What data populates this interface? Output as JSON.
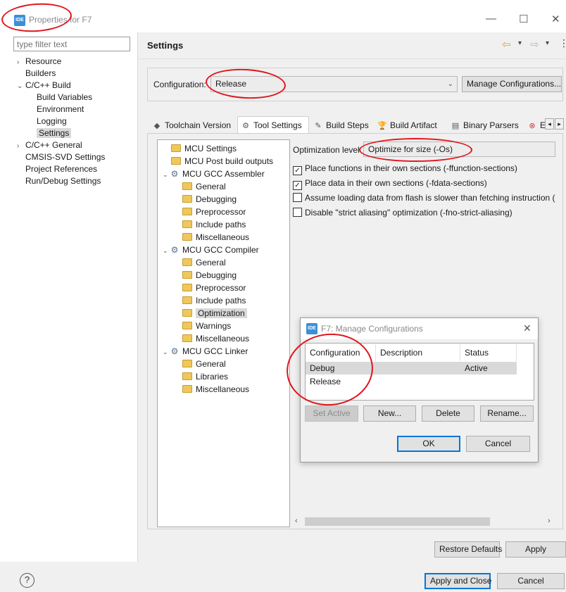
{
  "window": {
    "logo_text": "IDE",
    "title": "Properties for F7",
    "minimize": "—",
    "maximize": "☐",
    "close": "✕"
  },
  "left_tree": {
    "filter_placeholder": "type filter text",
    "items": [
      {
        "label": "Resource",
        "arrow": "›"
      },
      {
        "label": "Builders",
        "arrow": ""
      },
      {
        "label": "C/C++ Build",
        "arrow": "⌄"
      },
      {
        "label": "Build Variables",
        "arrow": ""
      },
      {
        "label": "Environment",
        "arrow": ""
      },
      {
        "label": "Logging",
        "arrow": ""
      },
      {
        "label": "Settings",
        "arrow": "",
        "selected": true
      },
      {
        "label": "C/C++ General",
        "arrow": "›"
      },
      {
        "label": "CMSIS-SVD Settings",
        "arrow": ""
      },
      {
        "label": "Project References",
        "arrow": ""
      },
      {
        "label": "Run/Debug Settings",
        "arrow": ""
      }
    ]
  },
  "settings": {
    "title": "Settings",
    "configuration_label": "Configuration:",
    "configuration_value": "Release",
    "manage_button": "Manage Configurations...",
    "tabs": [
      {
        "label": "Toolchain Version",
        "icon": "◆"
      },
      {
        "label": "Tool Settings",
        "icon": "⚙"
      },
      {
        "label": "Build Steps",
        "icon": "✎"
      },
      {
        "label": "Build Artifact",
        "icon": "🏆"
      },
      {
        "label": "Binary Parsers",
        "icon": "▤"
      },
      {
        "label": "E",
        "icon": "⊗"
      }
    ],
    "tool_tree": [
      {
        "label": "MCU Settings",
        "kind": "folder",
        "indent": 0
      },
      {
        "label": "MCU Post build outputs",
        "kind": "folder",
        "indent": 0
      },
      {
        "label": "MCU GCC Assembler",
        "kind": "gear",
        "indent": 0
      },
      {
        "label": "General",
        "kind": "folder",
        "indent": 1
      },
      {
        "label": "Debugging",
        "kind": "folder",
        "indent": 1
      },
      {
        "label": "Preprocessor",
        "kind": "folder",
        "indent": 1
      },
      {
        "label": "Include paths",
        "kind": "folder",
        "indent": 1
      },
      {
        "label": "Miscellaneous",
        "kind": "folder",
        "indent": 1
      },
      {
        "label": "MCU GCC Compiler",
        "kind": "gear",
        "indent": 0
      },
      {
        "label": "General",
        "kind": "folder",
        "indent": 1
      },
      {
        "label": "Debugging",
        "kind": "folder",
        "indent": 1
      },
      {
        "label": "Preprocessor",
        "kind": "folder",
        "indent": 1
      },
      {
        "label": "Include paths",
        "kind": "folder",
        "indent": 1
      },
      {
        "label": "Optimization",
        "kind": "folder",
        "indent": 1,
        "selected": true
      },
      {
        "label": "Warnings",
        "kind": "folder",
        "indent": 1
      },
      {
        "label": "Miscellaneous",
        "kind": "folder",
        "indent": 1
      },
      {
        "label": "MCU GCC Linker",
        "kind": "gear",
        "indent": 0
      },
      {
        "label": "General",
        "kind": "folder",
        "indent": 1
      },
      {
        "label": "Libraries",
        "kind": "folder",
        "indent": 1
      },
      {
        "label": "Miscellaneous",
        "kind": "folder",
        "indent": 1
      }
    ],
    "optimization_label": "Optimization level",
    "optimization_value": "Optimize for size (-Os)",
    "options": [
      {
        "label": "Place functions in their own sections (-ffunction-sections)",
        "checked": true
      },
      {
        "label": "Place data in their own sections (-fdata-sections)",
        "checked": true
      },
      {
        "label": "Assume loading data from flash is slower than fetching instruction (",
        "checked": false
      },
      {
        "label": "Disable \"strict aliasing\" optimization (-fno-strict-aliasing)",
        "checked": false
      }
    ],
    "restore_defaults": "Restore Defaults",
    "apply": "Apply"
  },
  "dialog": {
    "title": "F7: Manage Configurations",
    "columns": [
      "Configuration",
      "Description",
      "Status"
    ],
    "rows": [
      {
        "configuration": "Debug",
        "description": "",
        "status": "Active"
      },
      {
        "configuration": "Release",
        "description": "",
        "status": ""
      }
    ],
    "buttons": {
      "set_active": "Set Active",
      "new": "New...",
      "delete": "Delete",
      "rename": "Rename...",
      "ok": "OK",
      "cancel": "Cancel"
    }
  },
  "footer": {
    "help": "?",
    "apply_close": "Apply and Close",
    "cancel": "Cancel"
  },
  "colors": {
    "annotation_red": "#e0161d",
    "focus_blue": "#0078d7",
    "logo_blue": "#3c8fd6"
  }
}
